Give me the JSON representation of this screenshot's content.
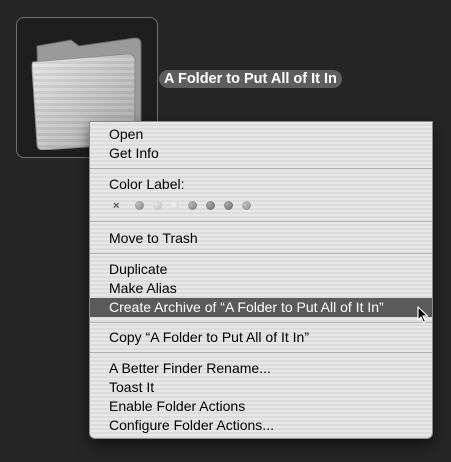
{
  "folder": {
    "name": "A Folder to Put All of It In",
    "icon": "folder-icon"
  },
  "menu": {
    "open": "Open",
    "get_info": "Get Info",
    "color_label": "Color Label:",
    "color_label_none": "×",
    "color_dots": [
      "gray",
      "light-gray",
      "light-gray",
      "gray",
      "dark-gray",
      "gray"
    ],
    "move_to_trash": "Move to Trash",
    "duplicate": "Duplicate",
    "make_alias": "Make Alias",
    "create_archive": "Create Archive of “A Folder to Put All of It In”",
    "copy": "Copy “A Folder to Put All of It In”",
    "better_finder_rename": "A Better Finder Rename...",
    "toast_it": "Toast It",
    "enable_folder_actions": "Enable Folder Actions",
    "configure_folder_actions": "Configure Folder Actions..."
  },
  "highlighted_item": "create_archive",
  "colors": {
    "desktop": "#262626",
    "highlight": "#5a5a5a",
    "menu_bg": "#e3e3e3"
  }
}
